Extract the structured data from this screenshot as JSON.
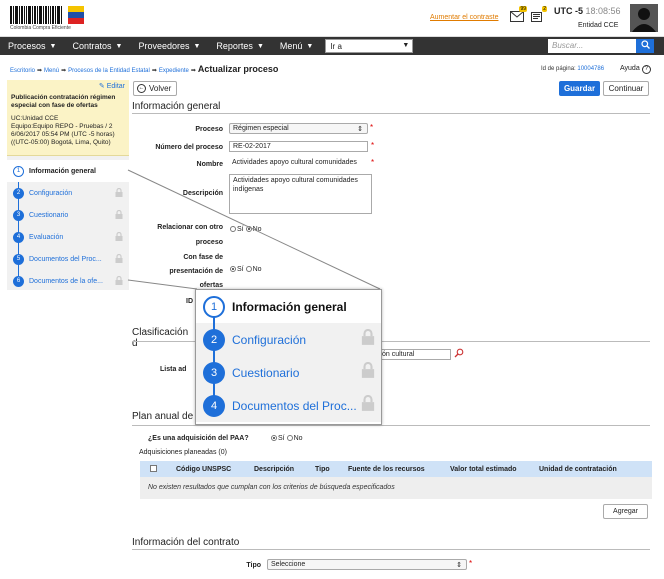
{
  "header": {
    "logo_caption": "Colombia Compra Eficiente",
    "increase_contrast": "Aumentar el contraste",
    "mail_badge": "99",
    "doc_badge": "2",
    "utc_label": "UTC -5",
    "time": "18:08:56",
    "entity": "Entidad CCE"
  },
  "nav": {
    "items": [
      "Procesos",
      "Contratos",
      "Proveedores",
      "Reportes",
      "Menú"
    ],
    "goto_value": "Ir a",
    "search_placeholder": "Buscar..."
  },
  "breadcrumb": {
    "items": [
      "Escritorio",
      "Menú",
      "Procesos de la Entidad Estatal",
      "Expediente"
    ],
    "current": "Actualizar proceso"
  },
  "page_id": {
    "label": "Id de página:",
    "value": "10004786"
  },
  "help_label": "Ayuda",
  "sidebar": {
    "edit_label": "Editar",
    "title": "Publicación contratación régimen especial con fase de ofertas",
    "info_lines": [
      "UC:Unidad CCE",
      "Equipo:Equipo REPO - Pruebas / 2",
      "6/06/2017 05:54 PM (UTC -5 horas)",
      "((UTC-05:00) Bogotá, Lima, Quito)"
    ],
    "steps": [
      {
        "num": "1",
        "label": "Información general"
      },
      {
        "num": "2",
        "label": "Configuración"
      },
      {
        "num": "3",
        "label": "Cuestionario"
      },
      {
        "num": "4",
        "label": "Evaluación"
      },
      {
        "num": "5",
        "label": "Documentos del Proc..."
      },
      {
        "num": "6",
        "label": "Documentos de la ofe..."
      }
    ]
  },
  "buttons": {
    "back": "Volver",
    "save": "Guardar",
    "continue": "Continuar",
    "add": "Agregar"
  },
  "general": {
    "section_title": "Información general",
    "proceso_label": "Proceso",
    "proceso_value": "Régimen especial",
    "numero_label": "Número del proceso",
    "numero_value": "RE-02-2017",
    "nombre_label": "Nombre",
    "nombre_value": "Actividades apoyo cultural comunidades",
    "descripcion_label": "Descripción",
    "descripcion_value": "Actividades apoyo cultural comunidades indígenas",
    "relacionar_label_1": "Relacionar con otro",
    "relacionar_label_2": "proceso",
    "fase_label_1": "Con fase de",
    "fase_label_2": "presentación de",
    "fase_label_3": "ofertas",
    "yes": "Sí",
    "no": "No",
    "id_label": "ID"
  },
  "classification": {
    "section_title": "Clasificación d",
    "list_label": "Lista ad",
    "field_value": "ón cultural"
  },
  "paa": {
    "section_title": "Plan anual de",
    "question": "¿Es una adquisición del PAA?",
    "planned": "Adquisiciones planeadas (0)",
    "columns": [
      "Código UNSPSC",
      "Descripción",
      "Tipo",
      "Fuente de los recursos",
      "Valor total estimado",
      "Unidad de contratación"
    ],
    "empty_message": "No existen resultados que cumplan con los criterios de búsqueda especificados"
  },
  "contract": {
    "section_title": "Información del contrato",
    "tipo_label": "Tipo",
    "tipo_value": "Seleccione"
  },
  "zoom": {
    "steps": [
      {
        "num": "1",
        "label": "Información general"
      },
      {
        "num": "2",
        "label": "Configuración"
      },
      {
        "num": "3",
        "label": "Cuestionario"
      },
      {
        "num": "4",
        "label": "Documentos del Proc..."
      }
    ]
  },
  "colors": {
    "accent": "#1e6fd9",
    "nav": "#333333",
    "note": "#fbf3c6",
    "table_head": "#cfe2f7"
  }
}
